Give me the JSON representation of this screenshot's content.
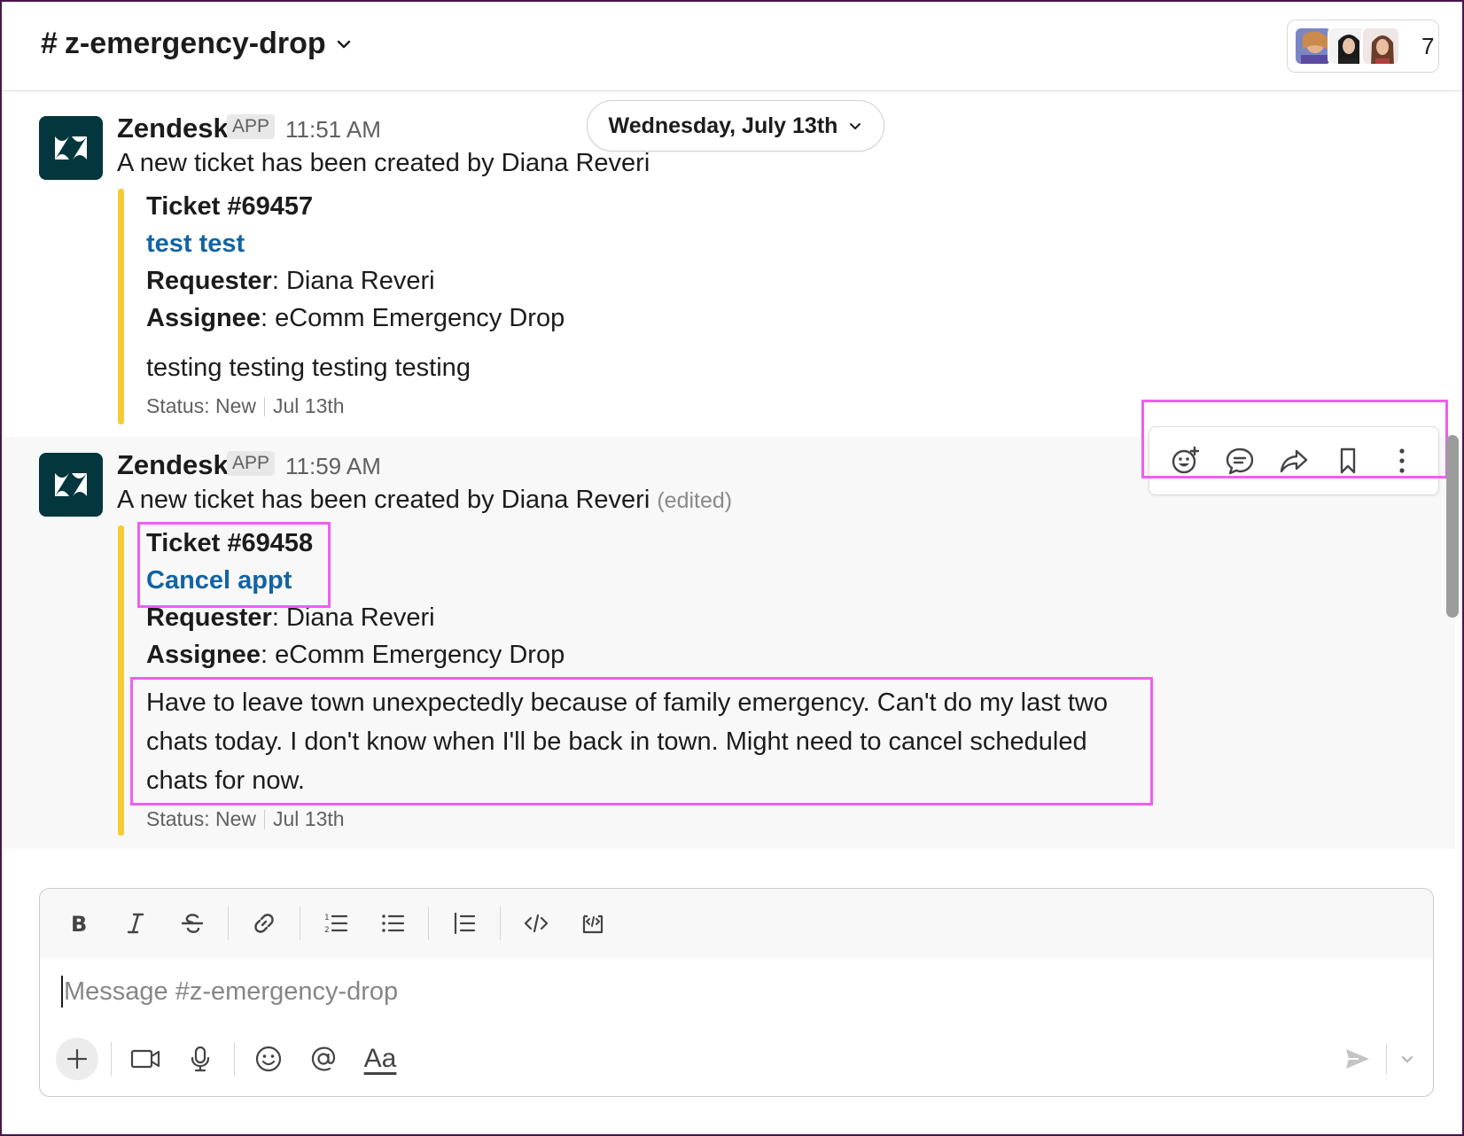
{
  "header": {
    "channel_hash": "#",
    "channel_name": "z-emergency-drop",
    "member_count": "7"
  },
  "date_divider": "Wednesday, July 13th",
  "messages": [
    {
      "sender": "Zendesk",
      "badge": "APP",
      "time": "11:51 AM",
      "intro": "A new ticket has been created by Diana Reveri",
      "edited": "",
      "ticket_id": "Ticket #69457",
      "ticket_title": "test test",
      "requester_label": "Requester",
      "requester_value": ": Diana Reveri",
      "assignee_label": "Assignee",
      "assignee_value": ": eComm Emergency Drop",
      "description": "testing testing testing testing",
      "status": "Status: New",
      "date": "Jul 13th"
    },
    {
      "sender": "Zendesk",
      "badge": "APP",
      "time": "11:59 AM",
      "intro": "A new ticket has been created by Diana Reveri",
      "edited": "(edited)",
      "ticket_id": "Ticket #69458",
      "ticket_title": "Cancel appt",
      "requester_label": "Requester",
      "requester_value": ": Diana Reveri",
      "assignee_label": "Assignee",
      "assignee_value": ": eComm Emergency Drop",
      "description": "Have to leave town unexpectedly because of family emergency. Can't do my last two chats today. I don't know when I'll be back in town. Might need to cancel scheduled chats for now.",
      "status": "Status: New",
      "date": "Jul 13th"
    }
  ],
  "message_actions": [
    "add-reaction-icon",
    "reply-thread-icon",
    "share-icon",
    "bookmark-icon",
    "more-actions-icon"
  ],
  "composer": {
    "placeholder": "Message #z-emergency-drop",
    "format_label": "Aa",
    "toolbar": [
      "bold-icon",
      "italic-icon",
      "strikethrough-icon",
      "link-icon",
      "ordered-list-icon",
      "bulleted-list-icon",
      "blockquote-icon",
      "code-icon",
      "code-block-icon"
    ]
  },
  "colors": {
    "zendesk_brand": "#03363d",
    "attachment_bar": "#f3cc33",
    "link": "#1264a3",
    "highlight": "#f05ef0"
  }
}
